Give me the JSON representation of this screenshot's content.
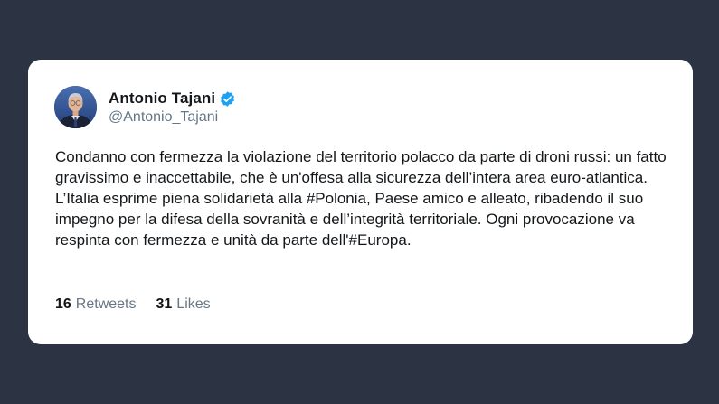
{
  "tweet": {
    "author": {
      "display_name": "Antonio Tajani",
      "handle": "@Antonio_Tajani",
      "verified": true,
      "avatar_icon": "profile-photo"
    },
    "text": "Condanno con fermezza la violazione del territorio polacco da parte di droni russi: un fatto gravissimo e inaccettabile, che è un'offesa alla sicurezza dell’intera area euro-atlantica. L’Italia esprime piena solidarietà alla #Polonia, Paese amico e alleato, ribadendo il suo impegno per la difesa della sovranità e dell’integrità territoriale. Ogni provocazione va respinta con fermezza e unità da parte dell'#Europa.",
    "stats": {
      "retweets_count": "16",
      "retweets_label": "Retweets",
      "likes_count": "31",
      "likes_label": "Likes"
    }
  },
  "colors": {
    "page_background": "#2c3444",
    "card_background": "#ffffff",
    "text_primary": "#14171a",
    "text_secondary": "#657786",
    "verified_blue": "#1da1f2"
  }
}
